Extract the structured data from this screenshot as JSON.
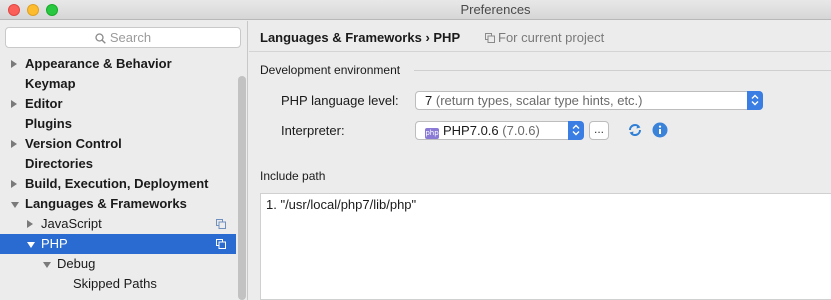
{
  "window": {
    "title": "Preferences"
  },
  "sidebar": {
    "search_placeholder": "Search",
    "items": [
      {
        "label": "Appearance & Behavior",
        "bold": true,
        "arrow": "right",
        "indent": 0
      },
      {
        "label": "Keymap",
        "bold": true,
        "arrow": "",
        "indent": 0
      },
      {
        "label": "Editor",
        "bold": true,
        "arrow": "right",
        "indent": 0
      },
      {
        "label": "Plugins",
        "bold": true,
        "arrow": "",
        "indent": 0
      },
      {
        "label": "Version Control",
        "bold": true,
        "arrow": "right",
        "indent": 0
      },
      {
        "label": "Directories",
        "bold": true,
        "arrow": "",
        "indent": 0
      },
      {
        "label": "Build, Execution, Deployment",
        "bold": true,
        "arrow": "right",
        "indent": 0
      },
      {
        "label": "Languages & Frameworks",
        "bold": true,
        "arrow": "down",
        "indent": 0
      },
      {
        "label": "JavaScript",
        "bold": false,
        "arrow": "right",
        "indent": 1,
        "copy_icon": true
      },
      {
        "label": "PHP",
        "bold": false,
        "arrow": "down",
        "indent": 1,
        "copy_icon": true,
        "selected": true
      },
      {
        "label": "Debug",
        "bold": false,
        "arrow": "down",
        "indent": 2
      },
      {
        "label": "Skipped Paths",
        "bold": false,
        "arrow": "",
        "indent": 3
      }
    ]
  },
  "main": {
    "breadcrumb": "Languages & Frameworks › PHP",
    "for_project": "For current project",
    "dev_env": {
      "title": "Development environment",
      "language_level_label": "PHP language level:",
      "language_level_value": "7",
      "language_level_hint": "(return types, scalar type hints, etc.)",
      "interpreter_label": "Interpreter:",
      "interpreter_badge": "php",
      "interpreter_value": "PHP7.0.6",
      "interpreter_version": "(7.0.6)",
      "browse_label": "..."
    },
    "include_path": {
      "title": "Include path",
      "entries": [
        "1. \"/usr/local/php7/lib/php\""
      ]
    }
  },
  "colors": {
    "selection": "#2a6bd1",
    "accent": "#3a7ee4",
    "php_badge": "#8a7ad6"
  }
}
